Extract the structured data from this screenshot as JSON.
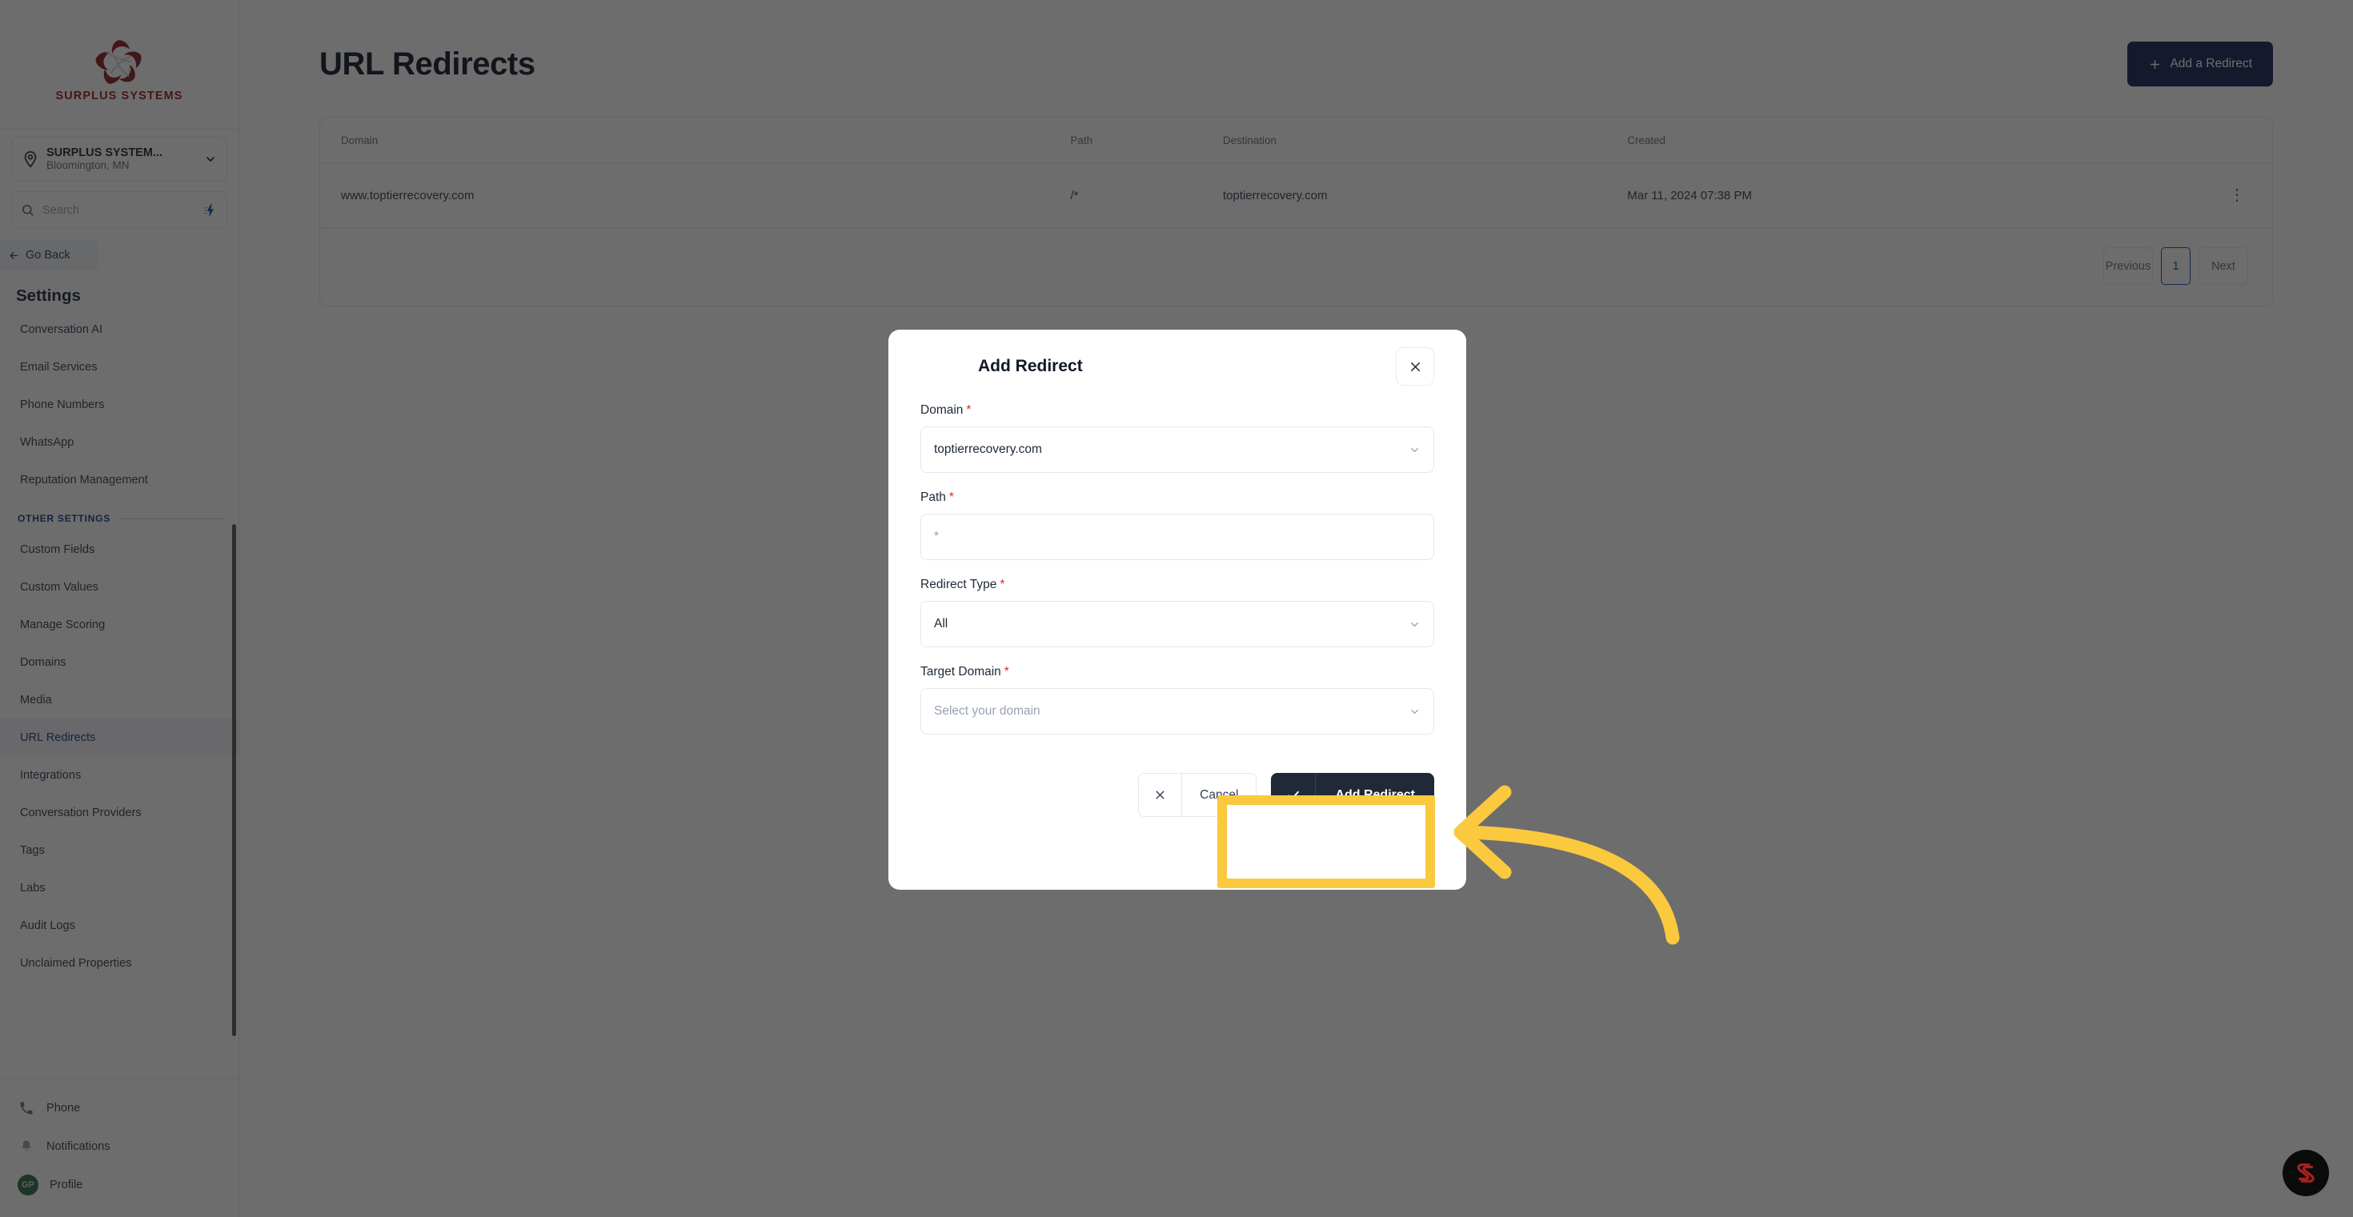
{
  "sidebar": {
    "brand": {
      "name": "SURPLUS SYSTEMS",
      "logo_icon": "surplus-systems-logo"
    },
    "location": {
      "pin_icon": "location-pin-icon",
      "title": "SURPLUS SYSTEM...",
      "subtitle": "Bloomington, MN",
      "chevron_icon": "chevron-down-icon"
    },
    "search": {
      "icon": "search-icon",
      "placeholder": "Search",
      "value": "",
      "shortcut_icon": "lightning-bolt-icon"
    },
    "go_back": {
      "label": "Go Back",
      "icon": "arrow-left-icon"
    },
    "settings_heading": "Settings",
    "items": [
      {
        "label": "Conversation AI",
        "active": false
      },
      {
        "label": "Email Services",
        "active": false
      },
      {
        "label": "Phone Numbers",
        "active": false
      },
      {
        "label": "WhatsApp",
        "active": false
      },
      {
        "label": "Reputation Management",
        "active": false
      }
    ],
    "section_label": "OTHER SETTINGS",
    "other_items": [
      {
        "label": "Custom Fields",
        "active": false
      },
      {
        "label": "Custom Values",
        "active": false
      },
      {
        "label": "Manage Scoring",
        "active": false
      },
      {
        "label": "Domains",
        "active": false
      },
      {
        "label": "Media",
        "active": false
      },
      {
        "label": "URL Redirects",
        "active": true
      },
      {
        "label": "Integrations",
        "active": false
      },
      {
        "label": "Conversation Providers",
        "active": false
      },
      {
        "label": "Tags",
        "active": false
      },
      {
        "label": "Labs",
        "active": false
      },
      {
        "label": "Audit Logs",
        "active": false
      },
      {
        "label": "Unclaimed Properties",
        "active": false
      }
    ],
    "footer": [
      {
        "label": "Phone",
        "icon": "phone-icon"
      },
      {
        "label": "Notifications",
        "icon": "bell-icon"
      },
      {
        "label": "Profile",
        "icon": "avatar",
        "initials": "GP"
      }
    ]
  },
  "main": {
    "title": "URL Redirects",
    "add_button": {
      "label": "Add a Redirect",
      "icon": "plus-icon"
    },
    "table": {
      "columns": [
        "Domain",
        "Path",
        "Destination",
        "Created",
        ""
      ],
      "rows": [
        {
          "domain": "www.toptierrecovery.com",
          "path": "/*",
          "destination": "toptierrecovery.com",
          "created": "Mar 11, 2024 07:38 PM",
          "menu_icon": "kebab-menu-icon"
        }
      ]
    },
    "pagination": {
      "previous": "Previous",
      "current_page": "1",
      "next": "Next"
    }
  },
  "modal": {
    "title": "Add Redirect",
    "close_icon": "close-icon",
    "fields": [
      {
        "label": "Domain",
        "required": "*",
        "value": "toptierrecovery.com",
        "placeholder": "",
        "type": "select",
        "icon": "chevron-down-icon"
      },
      {
        "label": "Path",
        "required": "*",
        "value": "",
        "placeholder": "*",
        "type": "input",
        "icon": ""
      },
      {
        "label": "Redirect Type",
        "required": "*",
        "value": "All",
        "placeholder": "",
        "type": "select",
        "icon": "chevron-down-icon"
      },
      {
        "label": "Target Domain",
        "required": "*",
        "value": "",
        "placeholder": "Select your domain",
        "type": "select",
        "icon": "chevron-down-icon"
      }
    ],
    "cancel_button": {
      "label": "Cancel",
      "icon": "close-icon"
    },
    "submit_button": {
      "label": "Add Redirect",
      "icon": "check-icon"
    }
  },
  "annotation": {
    "highlight_color": "#fbc93d",
    "arrow_icon": "curved-arrow-left-icon"
  },
  "fab": {
    "icon": "support-logo-icon"
  },
  "colors": {
    "accent": "#16235a",
    "active_nav": "#1e3a8a",
    "brand_red": "#9c1b1b",
    "required_red": "#d92d20",
    "submit_dark": "#1f2937",
    "highlight_yellow": "#fbc93d"
  }
}
